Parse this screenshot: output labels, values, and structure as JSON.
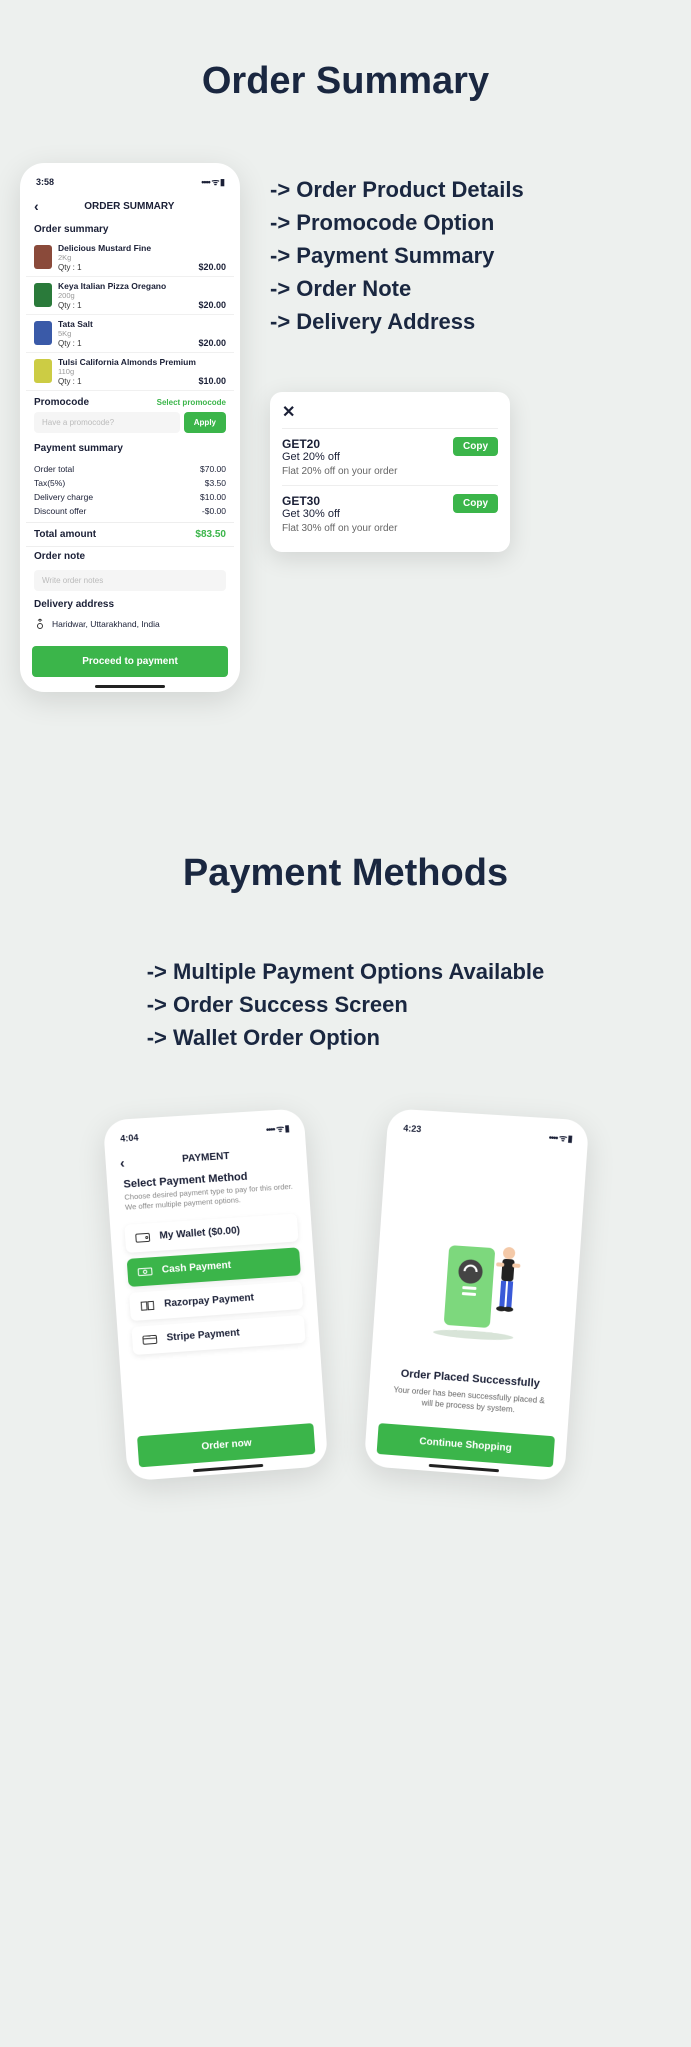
{
  "section1": {
    "title": "Order Summary",
    "features": [
      "-> Order Product Details",
      "-> Promocode Option",
      "-> Payment Summary",
      "-> Order Note",
      "-> Delivery Address"
    ]
  },
  "phone_order": {
    "time": "3:58",
    "app_bar": "ORDER SUMMARY",
    "sec_summary": "Order summary",
    "items": [
      {
        "name": "Delicious Mustard Fine",
        "sub": "2Kg",
        "qty": "Qty : 1",
        "price": "$20.00",
        "color": "#8a4a3a"
      },
      {
        "name": "Keya Italian Pizza Oregano",
        "sub": "200g",
        "qty": "Qty : 1",
        "price": "$20.00",
        "color": "#2a7a3a"
      },
      {
        "name": "Tata Salt",
        "sub": "5Kg",
        "qty": "Qty : 1",
        "price": "$20.00",
        "color": "#3a5aa8"
      },
      {
        "name": "Tulsi California Almonds Premium",
        "sub": "110g",
        "qty": "Qty : 1",
        "price": "$10.00",
        "color": "#cccc44"
      }
    ],
    "promo_title": "Promocode",
    "promo_select": "Select promocode",
    "promo_placeholder": "Have a promocode?",
    "apply": "Apply",
    "pay_title": "Payment summary",
    "rows": [
      {
        "label": "Order total",
        "value": "$70.00"
      },
      {
        "label": "Tax(5%)",
        "value": "$3.50"
      },
      {
        "label": "Delivery charge",
        "value": "$10.00"
      },
      {
        "label": "Discount offer",
        "value": "-$0.00"
      }
    ],
    "total_label": "Total amount",
    "total_value": "$83.50",
    "note_title": "Order note",
    "note_placeholder": "Write order notes",
    "addr_title": "Delivery address",
    "addr_text": "Haridwar, Uttarakhand, India",
    "proceed": "Proceed to payment"
  },
  "promo_popup": {
    "cards": [
      {
        "code": "GET20",
        "off": "Get 20% off",
        "desc": "Flat 20% off on your order",
        "copy": "Copy"
      },
      {
        "code": "GET30",
        "off": "Get 30% off",
        "desc": "Flat 30% off on your order",
        "copy": "Copy"
      }
    ]
  },
  "section2": {
    "title": "Payment Methods",
    "features": [
      "-> Multiple Payment Options Available",
      "-> Order Success Screen",
      "-> Wallet Order Option"
    ]
  },
  "phone_payment": {
    "time": "4:04",
    "app_bar": "PAYMENT",
    "heading": "Select Payment Method",
    "sub": "Choose desired payment type to pay for this order. We offer multiple payment options.",
    "options": [
      {
        "label": "My Wallet ($0.00)"
      },
      {
        "label": "Cash Payment"
      },
      {
        "label": "Razorpay Payment"
      },
      {
        "label": "Stripe Payment"
      }
    ],
    "cta": "Order now"
  },
  "phone_success": {
    "time": "4:23",
    "title": "Order Placed Successfully",
    "sub": "Your order has been successfully placed & will be process by system.",
    "cta": "Continue Shopping"
  }
}
